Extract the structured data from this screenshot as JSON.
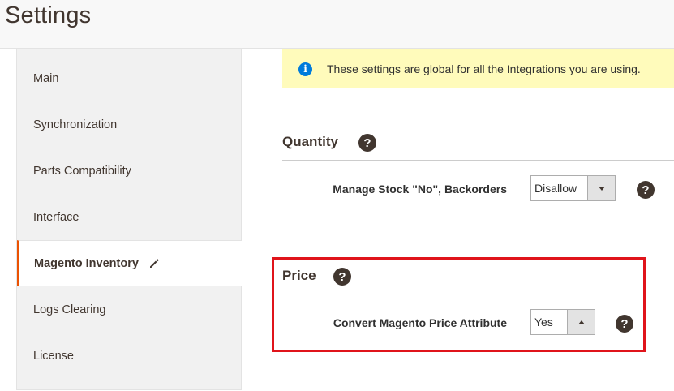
{
  "header": {
    "title": "Settings"
  },
  "sidebar": {
    "items": [
      {
        "label": "Main"
      },
      {
        "label": "Synchronization"
      },
      {
        "label": "Parts Compatibility"
      },
      {
        "label": "Interface"
      },
      {
        "label": "Magento Inventory",
        "active": true,
        "icon": "pencil-icon"
      },
      {
        "label": "Logs Clearing"
      },
      {
        "label": "License"
      }
    ]
  },
  "notice": {
    "text": "These settings are global for all the Integrations you are using.",
    "icon": "info-icon"
  },
  "quantity": {
    "title": "Quantity",
    "help_icon": "?",
    "field_label": "Manage Stock \"No\", Backorders",
    "field_value": "Disallow"
  },
  "price": {
    "title": "Price",
    "help_icon": "?",
    "field_label": "Convert Magento Price Attribute",
    "field_value": "Yes"
  },
  "colors": {
    "accent": "#eb5202",
    "highlight": "#e0141b",
    "notice_bg": "#fffbbb",
    "info": "#007bdb"
  }
}
